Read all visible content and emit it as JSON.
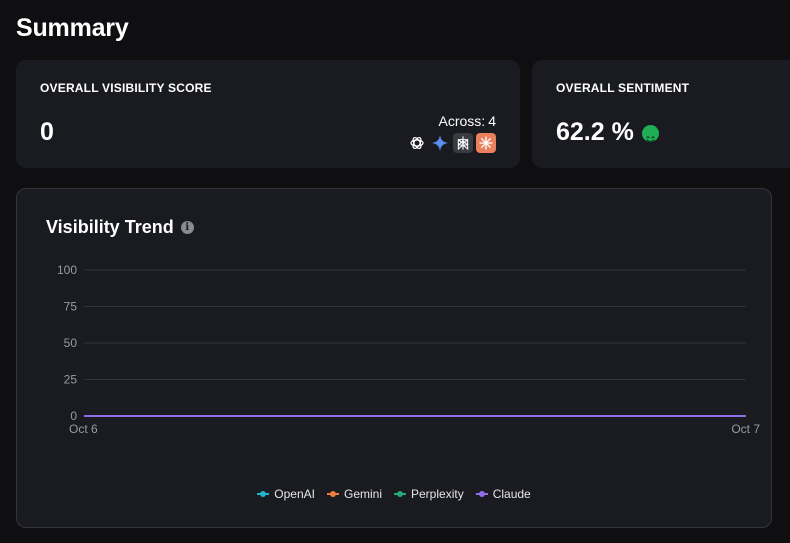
{
  "page": {
    "title": "Summary"
  },
  "visibility_card": {
    "label": "OVERALL VISIBILITY SCORE",
    "value": "0",
    "across_label": "Across:",
    "across_count": "4",
    "model_icons": [
      "openai-icon",
      "gemini-icon",
      "perplexity-icon",
      "claude-icon"
    ]
  },
  "sentiment_card": {
    "label": "OVERALL SENTIMENT",
    "value": "62.2 %",
    "icon": "smiley-icon",
    "icon_color": "#1fae55"
  },
  "trend": {
    "title": "Visibility Trend",
    "info_icon": "info-icon"
  },
  "chart_data": {
    "type": "line",
    "title": "Visibility Trend",
    "categories": [
      "Oct 6",
      "Oct 7"
    ],
    "y_ticks": [
      "100",
      "75",
      "50",
      "25",
      "0"
    ],
    "ylim": [
      0,
      100
    ],
    "grid": true,
    "legend_position": "bottom",
    "series": [
      {
        "name": "OpenAI",
        "color": "#22b5c9",
        "values": [
          0,
          0
        ]
      },
      {
        "name": "Gemini",
        "color": "#ef7d3b",
        "values": [
          0,
          0
        ]
      },
      {
        "name": "Perplexity",
        "color": "#25a979",
        "values": [
          0,
          0
        ]
      },
      {
        "name": "Claude",
        "color": "#8f6ee8",
        "values": [
          0,
          0
        ]
      }
    ]
  },
  "colors": {
    "background": "#0f0f12",
    "card": "#1a1b20",
    "grid": "#33343a"
  }
}
